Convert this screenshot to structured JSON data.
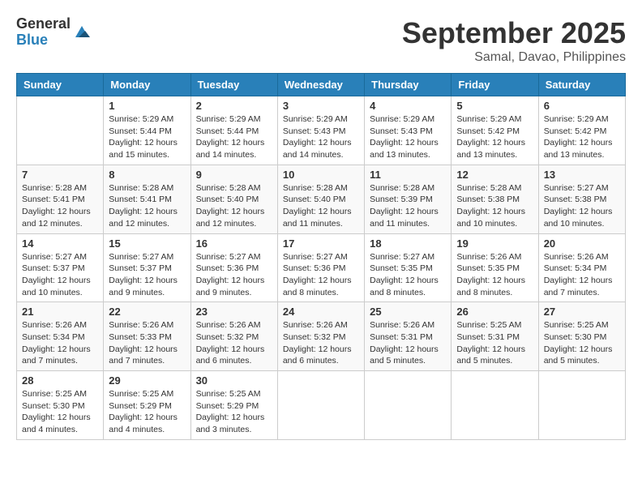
{
  "header": {
    "logo_general": "General",
    "logo_blue": "Blue",
    "month_title": "September 2025",
    "subtitle": "Samal, Davao, Philippines"
  },
  "days_of_week": [
    "Sunday",
    "Monday",
    "Tuesday",
    "Wednesday",
    "Thursday",
    "Friday",
    "Saturday"
  ],
  "weeks": [
    [
      {
        "day": "",
        "info": ""
      },
      {
        "day": "1",
        "info": "Sunrise: 5:29 AM\nSunset: 5:44 PM\nDaylight: 12 hours\nand 15 minutes."
      },
      {
        "day": "2",
        "info": "Sunrise: 5:29 AM\nSunset: 5:44 PM\nDaylight: 12 hours\nand 14 minutes."
      },
      {
        "day": "3",
        "info": "Sunrise: 5:29 AM\nSunset: 5:43 PM\nDaylight: 12 hours\nand 14 minutes."
      },
      {
        "day": "4",
        "info": "Sunrise: 5:29 AM\nSunset: 5:43 PM\nDaylight: 12 hours\nand 13 minutes."
      },
      {
        "day": "5",
        "info": "Sunrise: 5:29 AM\nSunset: 5:42 PM\nDaylight: 12 hours\nand 13 minutes."
      },
      {
        "day": "6",
        "info": "Sunrise: 5:29 AM\nSunset: 5:42 PM\nDaylight: 12 hours\nand 13 minutes."
      }
    ],
    [
      {
        "day": "7",
        "info": "Sunrise: 5:28 AM\nSunset: 5:41 PM\nDaylight: 12 hours\nand 12 minutes."
      },
      {
        "day": "8",
        "info": "Sunrise: 5:28 AM\nSunset: 5:41 PM\nDaylight: 12 hours\nand 12 minutes."
      },
      {
        "day": "9",
        "info": "Sunrise: 5:28 AM\nSunset: 5:40 PM\nDaylight: 12 hours\nand 12 minutes."
      },
      {
        "day": "10",
        "info": "Sunrise: 5:28 AM\nSunset: 5:40 PM\nDaylight: 12 hours\nand 11 minutes."
      },
      {
        "day": "11",
        "info": "Sunrise: 5:28 AM\nSunset: 5:39 PM\nDaylight: 12 hours\nand 11 minutes."
      },
      {
        "day": "12",
        "info": "Sunrise: 5:28 AM\nSunset: 5:38 PM\nDaylight: 12 hours\nand 10 minutes."
      },
      {
        "day": "13",
        "info": "Sunrise: 5:27 AM\nSunset: 5:38 PM\nDaylight: 12 hours\nand 10 minutes."
      }
    ],
    [
      {
        "day": "14",
        "info": "Sunrise: 5:27 AM\nSunset: 5:37 PM\nDaylight: 12 hours\nand 10 minutes."
      },
      {
        "day": "15",
        "info": "Sunrise: 5:27 AM\nSunset: 5:37 PM\nDaylight: 12 hours\nand 9 minutes."
      },
      {
        "day": "16",
        "info": "Sunrise: 5:27 AM\nSunset: 5:36 PM\nDaylight: 12 hours\nand 9 minutes."
      },
      {
        "day": "17",
        "info": "Sunrise: 5:27 AM\nSunset: 5:36 PM\nDaylight: 12 hours\nand 8 minutes."
      },
      {
        "day": "18",
        "info": "Sunrise: 5:27 AM\nSunset: 5:35 PM\nDaylight: 12 hours\nand 8 minutes."
      },
      {
        "day": "19",
        "info": "Sunrise: 5:26 AM\nSunset: 5:35 PM\nDaylight: 12 hours\nand 8 minutes."
      },
      {
        "day": "20",
        "info": "Sunrise: 5:26 AM\nSunset: 5:34 PM\nDaylight: 12 hours\nand 7 minutes."
      }
    ],
    [
      {
        "day": "21",
        "info": "Sunrise: 5:26 AM\nSunset: 5:34 PM\nDaylight: 12 hours\nand 7 minutes."
      },
      {
        "day": "22",
        "info": "Sunrise: 5:26 AM\nSunset: 5:33 PM\nDaylight: 12 hours\nand 7 minutes."
      },
      {
        "day": "23",
        "info": "Sunrise: 5:26 AM\nSunset: 5:32 PM\nDaylight: 12 hours\nand 6 minutes."
      },
      {
        "day": "24",
        "info": "Sunrise: 5:26 AM\nSunset: 5:32 PM\nDaylight: 12 hours\nand 6 minutes."
      },
      {
        "day": "25",
        "info": "Sunrise: 5:26 AM\nSunset: 5:31 PM\nDaylight: 12 hours\nand 5 minutes."
      },
      {
        "day": "26",
        "info": "Sunrise: 5:25 AM\nSunset: 5:31 PM\nDaylight: 12 hours\nand 5 minutes."
      },
      {
        "day": "27",
        "info": "Sunrise: 5:25 AM\nSunset: 5:30 PM\nDaylight: 12 hours\nand 5 minutes."
      }
    ],
    [
      {
        "day": "28",
        "info": "Sunrise: 5:25 AM\nSunset: 5:30 PM\nDaylight: 12 hours\nand 4 minutes."
      },
      {
        "day": "29",
        "info": "Sunrise: 5:25 AM\nSunset: 5:29 PM\nDaylight: 12 hours\nand 4 minutes."
      },
      {
        "day": "30",
        "info": "Sunrise: 5:25 AM\nSunset: 5:29 PM\nDaylight: 12 hours\nand 3 minutes."
      },
      {
        "day": "",
        "info": ""
      },
      {
        "day": "",
        "info": ""
      },
      {
        "day": "",
        "info": ""
      },
      {
        "day": "",
        "info": ""
      }
    ]
  ]
}
